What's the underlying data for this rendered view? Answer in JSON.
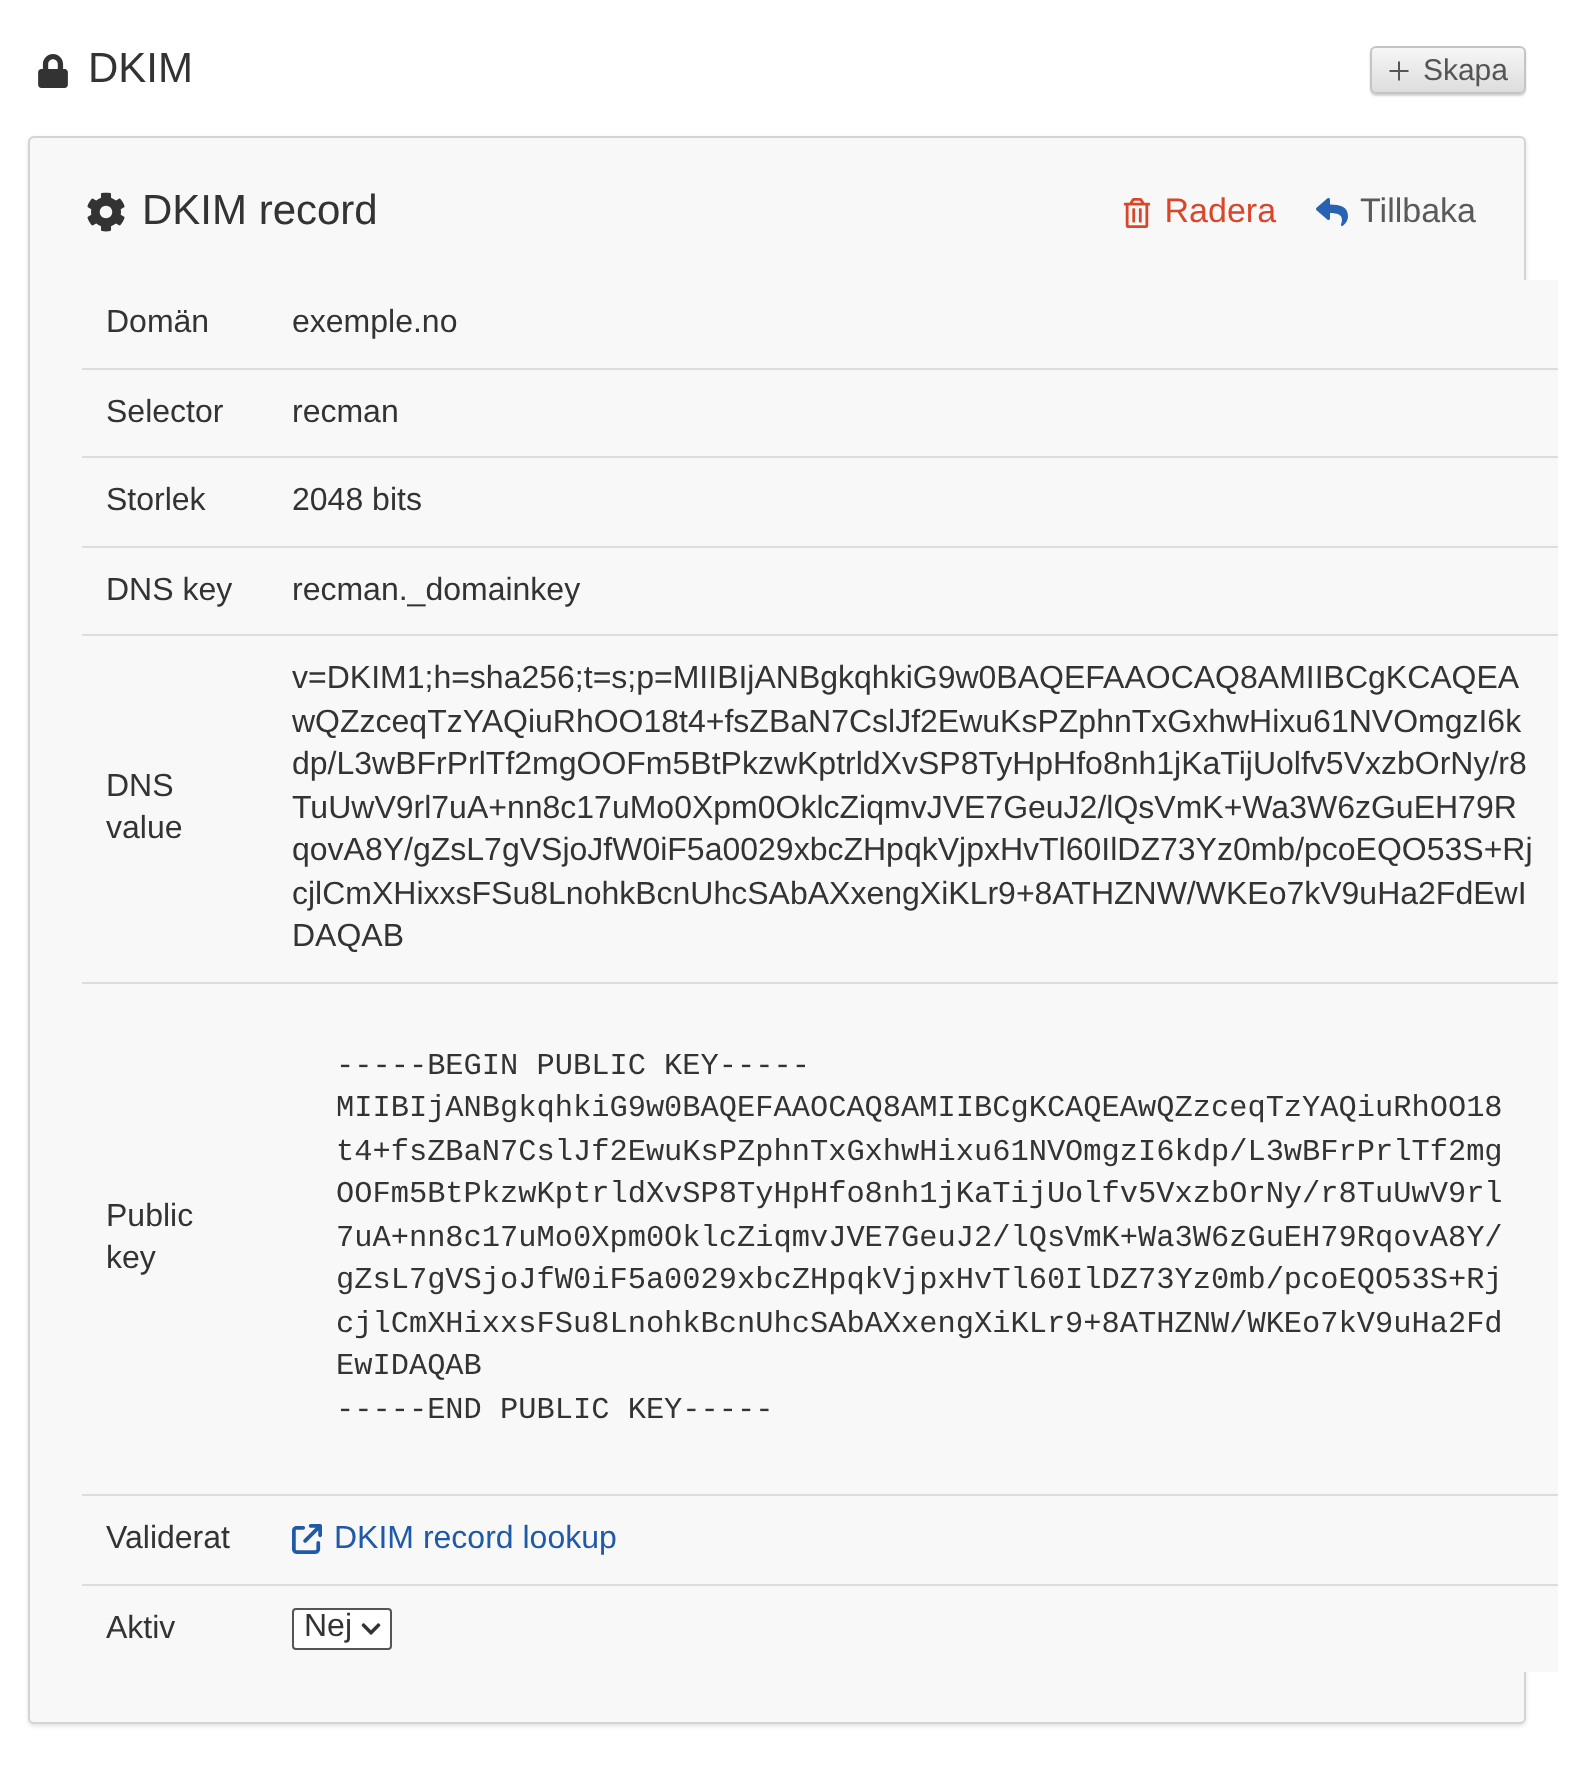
{
  "page_header": {
    "title": "DKIM",
    "create_button": "Skapa"
  },
  "card": {
    "title": "DKIM record",
    "actions": [
      {
        "kind": "delete",
        "label": "Radera"
      },
      {
        "kind": "back",
        "label": "Tillbaka"
      }
    ]
  },
  "fields": [
    {
      "kind": "text",
      "label": "Domän",
      "value": "exemple.no"
    },
    {
      "kind": "text",
      "label": "Selector",
      "value": "recman"
    },
    {
      "kind": "text",
      "label": "Storlek",
      "value": "2048 bits"
    },
    {
      "kind": "text",
      "label": "DNS key",
      "value": "recman._domainkey"
    },
    {
      "kind": "text",
      "label": "DNS value",
      "value": "v=DKIM1;h=sha256;t=s;p=MIIBIjANBgkqhkiG9w0BAQEFAAOCAQ8AMIIBCgKCAQEAwQZzceqTzYAQiuRhOO18t4+fsZBaN7CslJf2EwuKsPZphnTxGxhwHixu61NVOmgzI6kdp/L3wBFrPrlTf2mgOOFm5BtPkzwKptrldXvSP8TyHpHfo8nh1jKaTijUolfv5VxzbOrNy/r8TuUwV9rl7uA+nn8c17uMo0Xpm0OklcZiqmvJVE7GeuJ2/lQsVmK+Wa3W6zGuEH79RqovA8Y/gZsL7gVSjoJfW0iF5a0029xbcZHpqkVjpxHvTl60IlDZ73Yz0mb/pcoEQO53S+RjcjlCmXHixxsFSu8LnohkBcnUhcSAbAXxengXiKLr9+8ATHZNW/WKEo7kV9uHa2FdEwIDAQAB"
    },
    {
      "kind": "code",
      "label": "Public key",
      "value": "-----BEGIN PUBLIC KEY-----\nMIIBIjANBgkqhkiG9w0BAQEFAAOCAQ8AMIIBCgKCAQEAwQZzceqTzYAQiuRhOO18\nt4+fsZBaN7CslJf2EwuKsPZphnTxGxhwHixu61NVOmgzI6kdp/L3wBFrPrlTf2mg\nOOFm5BtPkzwKptrldXvSP8TyHpHfo8nh1jKaTijUolfv5VxzbOrNy/r8TuUwV9rl\n7uA+nn8c17uMo0Xpm0OklcZiqmvJVE7GeuJ2/lQsVmK+Wa3W6zGuEH79RqovA8Y/\ngZsL7gVSjoJfW0iF5a0029xbcZHpqkVjpxHvTl60IlDZ73Yz0mb/pcoEQO53S+Rj\ncjlCmXHixxsFSu8LnohkBcnUhcSAbAXxengXiKLr9+8ATHZNW/WKEo7kV9uHa2Fd\nEwIDAQAB\n-----END PUBLIC KEY-----"
    },
    {
      "kind": "link",
      "label": "Validerat",
      "value": "DKIM record lookup"
    },
    {
      "kind": "select",
      "label": "Aktiv",
      "value": "Nej"
    }
  ]
}
